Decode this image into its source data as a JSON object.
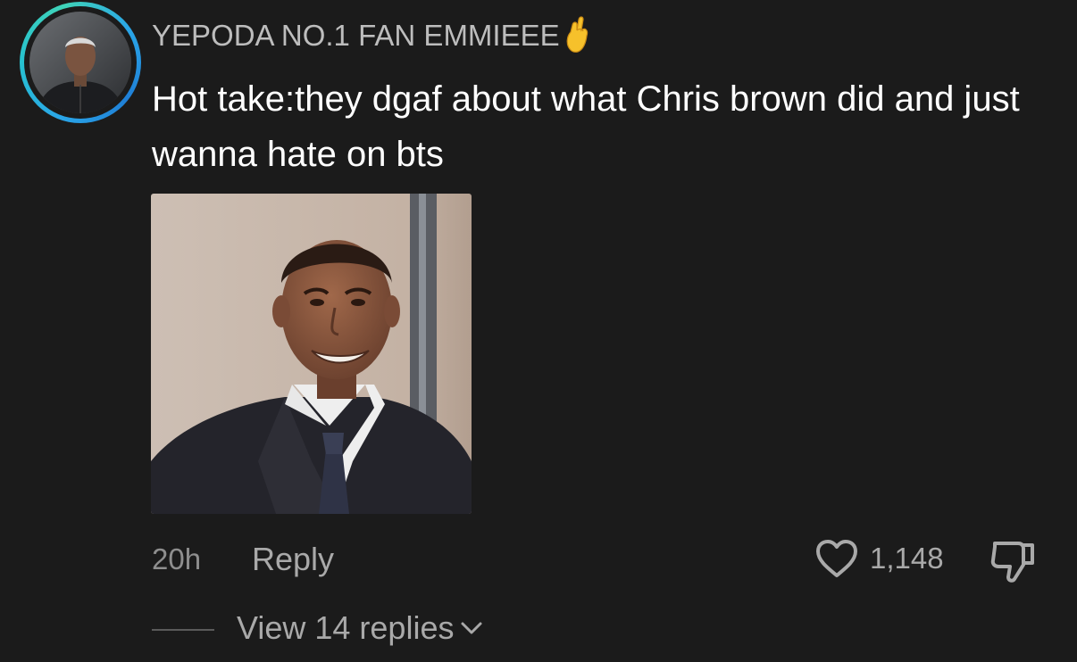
{
  "comment": {
    "username": "YEPODA NO.1 FAN EMMIEEE",
    "username_emoji": "crossed-fingers-emoji",
    "text": "Hot take:they dgaf about what Chris brown did and just wanna hate on bts",
    "time": "20h",
    "reply_label": "Reply",
    "like_count": "1,148",
    "view_replies_label": "View 14 replies"
  },
  "colors": {
    "background": "#1b1b1b",
    "ring": "#2aa6e8",
    "muted_text": "#a9a9a9"
  }
}
